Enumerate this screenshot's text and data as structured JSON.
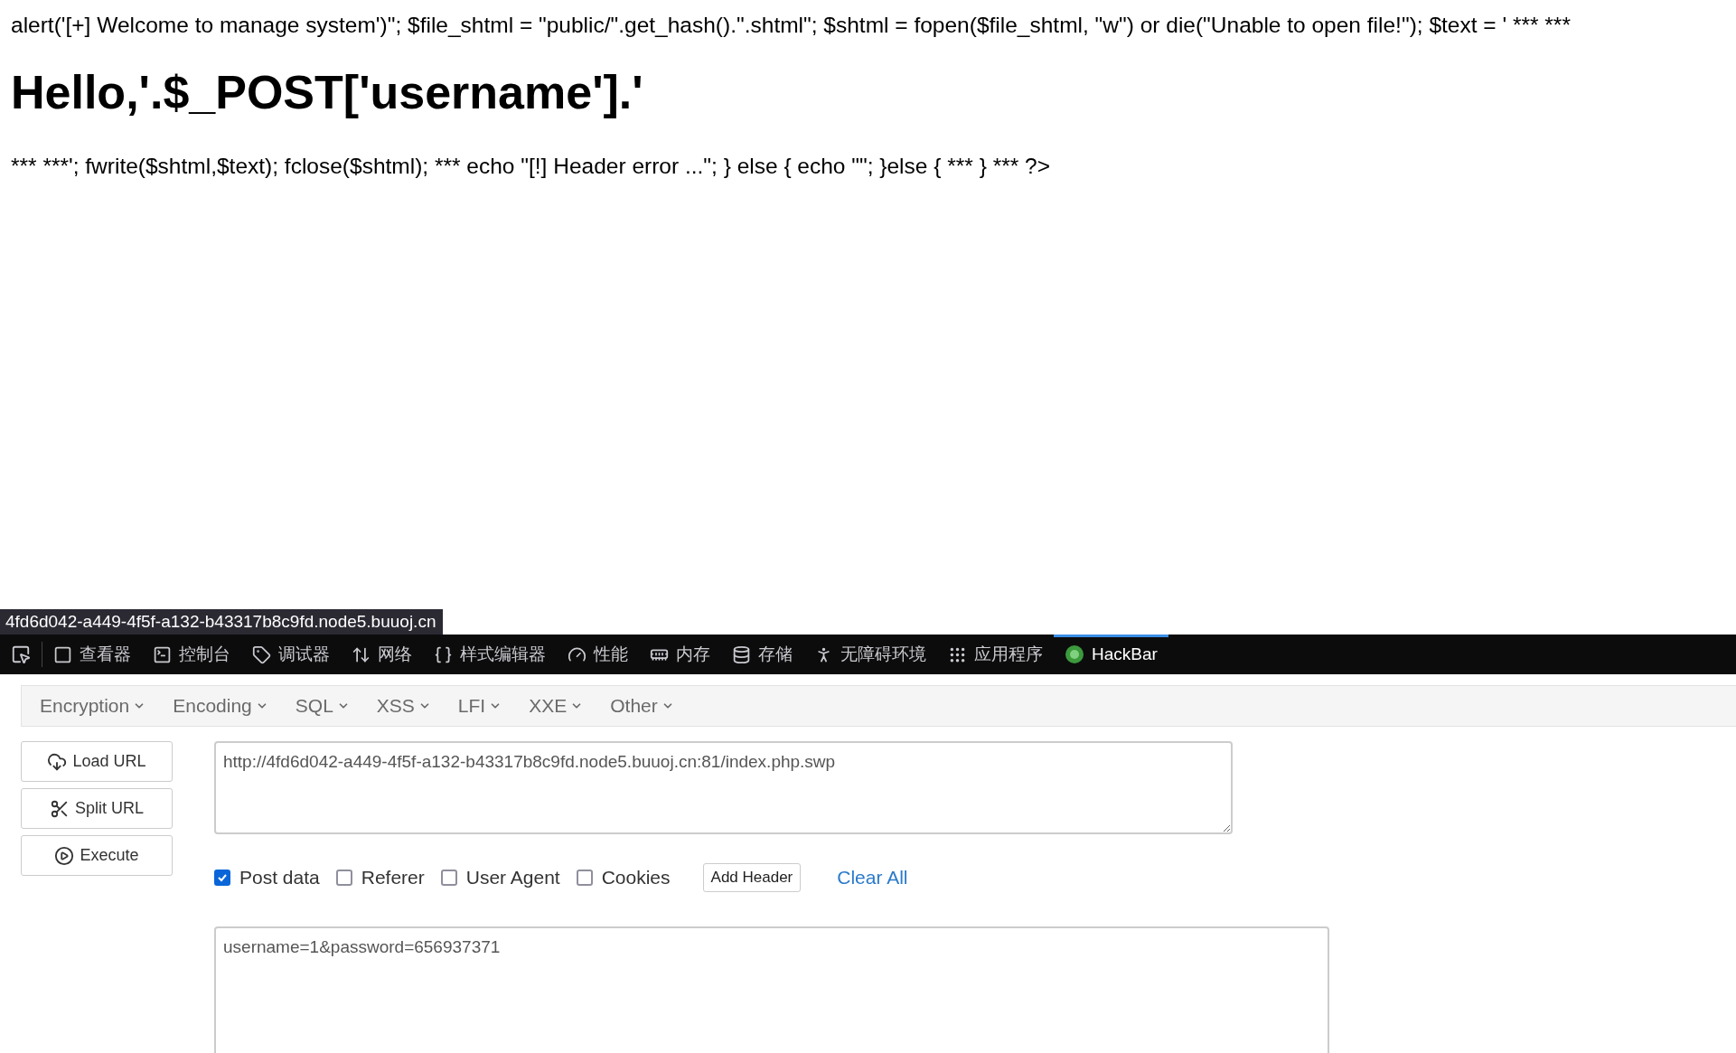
{
  "page": {
    "lines": [
      {
        "kind": "text",
        "text": "alert('[+] Welcome to manage system')\"; $file_shtml = \"public/\".get_hash().\".shtml\"; $shtml = fopen($file_shtml, \"w\") or die(\"Unable to open file!\"); $text = ' *** ***"
      },
      {
        "kind": "heading",
        "text": "Hello,'.$_POST['username'].'"
      },
      {
        "kind": "text",
        "text": "*** ***'; fwrite($shtml,$text); fclose($shtml); *** echo \"[!] Header error ...\"; } else { echo \"\"; }else { *** } *** ?>"
      }
    ]
  },
  "status_url": "4fd6d042-a449-4f5f-a132-b43317b8c9fd.node5.buuoj.cn",
  "devtools_tabs": [
    {
      "label": "查看器",
      "selected": false
    },
    {
      "label": "控制台",
      "selected": false
    },
    {
      "label": "调试器",
      "selected": false
    },
    {
      "label": "网络",
      "selected": false
    },
    {
      "label": "样式编辑器",
      "selected": false
    },
    {
      "label": "性能",
      "selected": false
    },
    {
      "label": "内存",
      "selected": false
    },
    {
      "label": "存储",
      "selected": false
    },
    {
      "label": "无障碍环境",
      "selected": false
    },
    {
      "label": "应用程序",
      "selected": false
    },
    {
      "label": "HackBar",
      "selected": true
    }
  ],
  "hackbar": {
    "menus": [
      "Encryption",
      "Encoding",
      "SQL",
      "XSS",
      "LFI",
      "XXE",
      "Other"
    ],
    "actions": [
      {
        "kind": "load",
        "label": "Load URL"
      },
      {
        "kind": "split",
        "label": "Split URL"
      },
      {
        "kind": "execute",
        "label": "Execute"
      }
    ],
    "url": "http://4fd6d042-a449-4f5f-a132-b43317b8c9fd.node5.buuoj.cn:81/index.php.swp",
    "options": [
      {
        "label": "Post data",
        "checked": true
      },
      {
        "label": "Referer",
        "checked": false
      },
      {
        "label": "User Agent",
        "checked": false
      },
      {
        "label": "Cookies",
        "checked": false
      }
    ],
    "add_header": "Add Header",
    "clear_all": "Clear All",
    "post_body": "username=1&password=656937371"
  }
}
